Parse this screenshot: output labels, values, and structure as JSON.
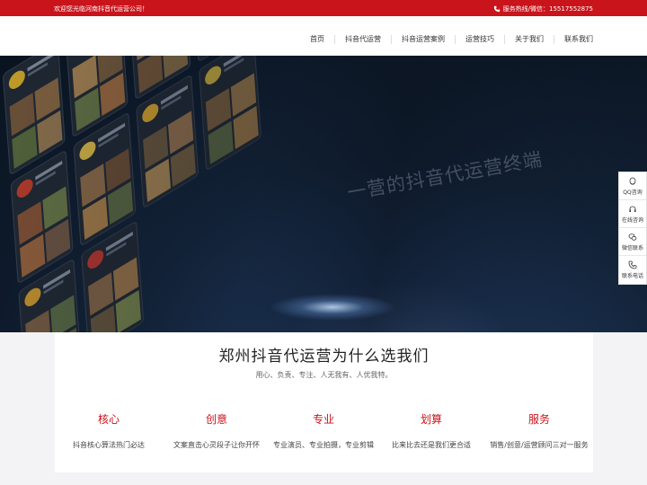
{
  "topbar": {
    "welcome": "欢迎您光临河南抖音代运营公司！",
    "hotline": "服务热线/微信：15517552875",
    "phone_icon": "phone-icon"
  },
  "nav": {
    "items": [
      "首页",
      "抖音代运营",
      "抖音运营案例",
      "运营技巧",
      "关于我们",
      "联系我们"
    ]
  },
  "banner": {
    "overlay_text": "一营的抖音代运营终端",
    "prev_icon": "chevron-left-icon",
    "next_icon": "chevron-right-icon",
    "scroll_icon": "mouse-scroll-icon"
  },
  "side": {
    "items": [
      {
        "label": "QQ咨询",
        "icon": "qq-icon"
      },
      {
        "label": "在线咨询",
        "icon": "headset-icon"
      },
      {
        "label": "微信联系",
        "icon": "wechat-icon"
      },
      {
        "label": "联系电话",
        "icon": "phone-icon"
      }
    ]
  },
  "why": {
    "title": "郑州抖音代运营为什么选我们",
    "subtitle": "用心、负责、专注、人无我有、人优我特。",
    "features": [
      {
        "title": "核心",
        "desc": "抖音核心算法热门必达"
      },
      {
        "title": "创意",
        "desc": "文案直击心灵段子让你开怀"
      },
      {
        "title": "专业",
        "desc": "专业演员、专业拍摄，专业剪辑"
      },
      {
        "title": "划算",
        "desc": "比来比去还是我们更合适"
      },
      {
        "title": "服务",
        "desc": "销售/创意/运营顾问三对一服务"
      }
    ]
  },
  "colors": {
    "brand": "#c9141b"
  }
}
